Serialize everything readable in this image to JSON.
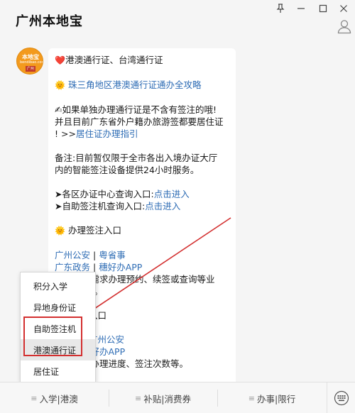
{
  "window": {
    "title": "广州本地宝",
    "controls": [
      "pin-icon",
      "minimize-icon",
      "maximize-icon",
      "close-icon"
    ],
    "user_icon": "user-icon"
  },
  "message": {
    "avatar": {
      "top_text": "本地宝",
      "mid_text": "bendibao.com",
      "bottom_text": "广州"
    },
    "lines": {
      "l1_emoji": "❤️",
      "l1_text": "港澳通行证、台湾通行证",
      "l2_emoji": "🌞",
      "l2_text": "珠三角地区港澳通行证通办全攻略",
      "l3a": "✍如果单独办理通行证是不含有签注的哦!",
      "l3b": "并且目前广东省外户籍办旅游签都要居住证",
      "l3c_prefix": "! >>",
      "l3c_link": "居住证办理指引",
      "l4a": "备注:目前暂仅限于全市各出入境办证大厅",
      "l4b": "内的智能签注设备提供24小时服务。",
      "l5a_prefix": "➤各区办证中心查询入口:",
      "l5a_link": "点击进入",
      "l5b_prefix": "➤自助签注机查询入口:",
      "l5b_link": "点击进入",
      "l6_emoji": "🌞",
      "l6_text": "办理签注入口",
      "l7a_link1": "广州公安",
      "l7a_sep": " | ",
      "l7a_link2": "粤省事",
      "l7b_link1": "广东政务",
      "l7b_sep": " | ",
      "l7b_link2": "穗好办APP",
      "l7c": "人需求办理预约、续签或查询等业",
      "l7d": "地)。",
      "l8_text": "入口",
      "l9_link": "广州公安",
      "l9b_link": "穗好办APP",
      "l10": "询办理进度、签注次数等。"
    }
  },
  "popup_menu": {
    "items": [
      "积分入学",
      "异地身份证",
      "自助签注机",
      "港澳通行证",
      "居住证"
    ],
    "highlighted_index": 3
  },
  "bottom_bar": {
    "tabs": [
      "入学|港澳",
      "补贴|消费券",
      "办事|限行"
    ],
    "keyboard_icon": "keyboard-icon"
  },
  "colors": {
    "link": "#2f6db5",
    "highlight_box": "#d32f2f",
    "arrow": "#d32f2f"
  }
}
